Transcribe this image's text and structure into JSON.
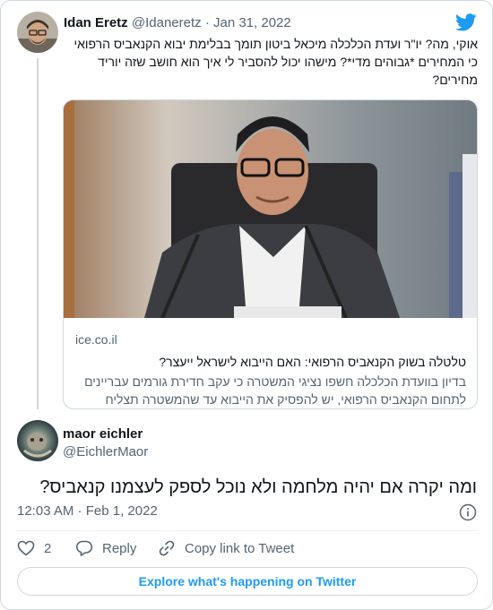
{
  "tweet": {
    "author_name": "Idan Eretz",
    "author_handle": "@Idaneretz",
    "separator": "·",
    "date": "Jan 31, 2022",
    "text_lines": [
      "אוקי, מה? יו\"ר ועדת הכלכלה מיכאל ביטון תומך בבלימת יבוא הקנאביס הרפואי",
      "כי המחירים *גבוהים מדי*? מישהו יכול להסביר לי איך הוא חושב שזה יוריד",
      "מחירים?"
    ],
    "link_card": {
      "domain": "ice.co.il",
      "title": "טלטלה בשוק הקנאביס הרפואי: האם הייבוא לישראל ייעצר?",
      "description_lines": [
        "בדיון בוועדת הכלכלה חשפו נציגי המשטרה כי עקב חדירת גורמים עבריינים",
        "לתחום הקנאביס הרפואי, יש להפסיק את הייבוא עד שהמשטרה תצליח"
      ]
    }
  },
  "reply": {
    "author_name": "maor eichler",
    "author_handle": "@EichlerMaor",
    "text": "ומה יקרה אם יהיה מלחמה ולא נוכל לספק לעצמנו קנאביס?",
    "timestamp": "12:03 AM · Feb 1, 2022",
    "like_count": "2",
    "reply_label": "Reply",
    "copy_link_label": "Copy link to Tweet"
  },
  "explore_label": "Explore what's happening on Twitter",
  "colors": {
    "accent": "#1d9bf0",
    "text": "#0f1419",
    "muted": "#536471",
    "border": "#cfd9de"
  },
  "icons": [
    "twitter-bird-icon",
    "info-icon",
    "heart-icon",
    "reply-bubble-icon",
    "link-icon"
  ]
}
